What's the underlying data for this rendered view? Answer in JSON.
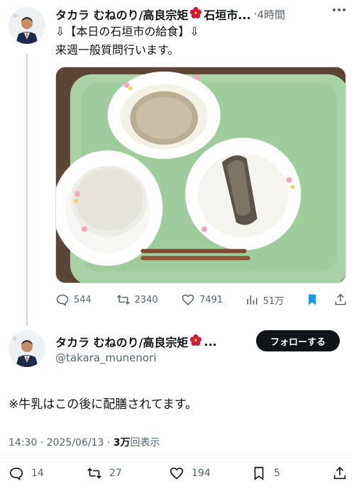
{
  "tweet1": {
    "display_name": "タカラ むねのり/高良宗矩",
    "name_suffix": "石垣市...",
    "separator": "·",
    "time": "4時間",
    "line1": "⇩【本日の石垣市の給食】⇩",
    "line2": "来週一般質問行います。",
    "image_alt": "school lunch on green tray",
    "actions": {
      "replies": "544",
      "retweets": "2340",
      "likes": "7491",
      "views": "51万"
    }
  },
  "tweet2": {
    "display_name": "タカラ むねのり/高良宗矩",
    "name_suffix": "...",
    "handle": "@takara_munenori",
    "follow_label": "フォローする",
    "text": "※牛乳はこの後に配膳されてます。",
    "timestamp": "14:30 · 2025/06/13 · ",
    "views_count": "3万",
    "views_label": "回表示",
    "actions": {
      "replies": "14",
      "retweets": "27",
      "likes": "194",
      "bookmarks": "5"
    }
  },
  "icons": {
    "reply": "reply-icon",
    "retweet": "retweet-icon",
    "like": "heart-icon",
    "views": "views-icon",
    "bookmark": "bookmark-icon",
    "share": "share-icon",
    "more": "more-icon",
    "flower": "hibiscus-icon"
  },
  "colors": {
    "text": "#0f1419",
    "muted": "#536471",
    "accent": "#1d9bf0",
    "follow_bg": "#0f1419"
  }
}
